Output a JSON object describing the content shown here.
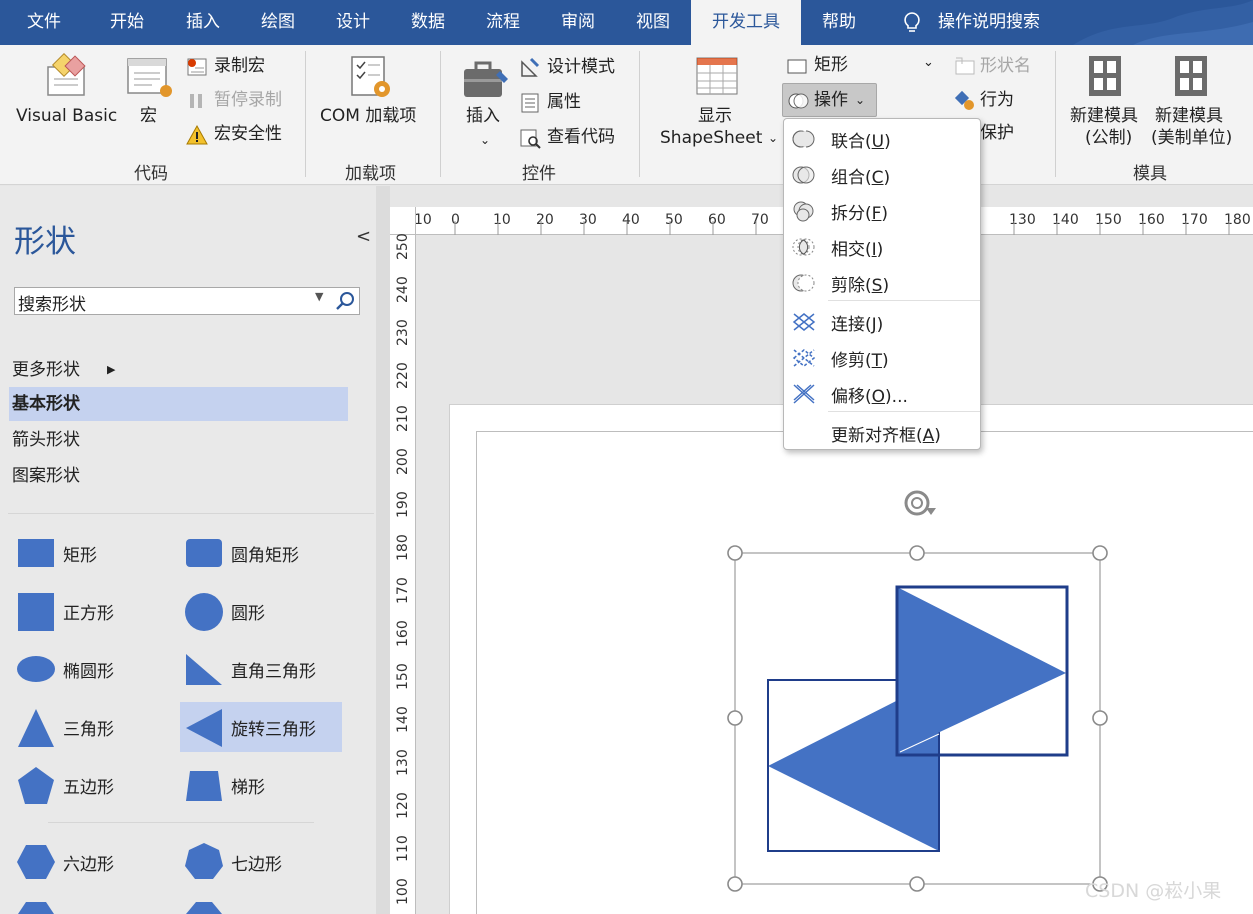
{
  "menubar": {
    "tabs": [
      {
        "label": "文件"
      },
      {
        "label": "开始"
      },
      {
        "label": "插入"
      },
      {
        "label": "绘图"
      },
      {
        "label": "设计"
      },
      {
        "label": "数据"
      },
      {
        "label": "流程"
      },
      {
        "label": "审阅"
      },
      {
        "label": "视图"
      },
      {
        "label": "开发工具"
      },
      {
        "label": "帮助"
      }
    ],
    "active_tab": "开发工具",
    "tell_me": "操作说明搜索",
    "bar_color": "#2b579a"
  },
  "ribbon": {
    "code": {
      "visual_basic": "Visual Basic",
      "macros": "宏",
      "record_macro": "录制宏",
      "pause_recording": "暂停录制",
      "macro_security": "宏安全性",
      "group_label": "代码"
    },
    "addins": {
      "com_addins": "COM 加载项",
      "group_label": "加载项"
    },
    "controls": {
      "insert": "插入",
      "design_mode": "设计模式",
      "properties": "属性",
      "view_code": "查看代码",
      "group_label": "控件"
    },
    "shape_design": {
      "show_shapesheet_line1": "显示",
      "show_shapesheet_line2": "ShapeSheet",
      "rectangle": "矩形",
      "operations": "操作",
      "shape_name": "形状名",
      "behavior": "行为",
      "protection": "保护"
    },
    "stencil": {
      "new_stencil_metric_line1": "新建模具",
      "new_stencil_metric_line2": "(公制)",
      "new_stencil_us_line1": "新建模具",
      "new_stencil_us_line2": "(美制单位)",
      "group_label": "模具"
    }
  },
  "operations_menu": {
    "items": [
      {
        "label": "联合",
        "key": "U",
        "icon": "union-icon"
      },
      {
        "label": "组合",
        "key": "C",
        "icon": "combine-icon"
      },
      {
        "label": "拆分",
        "key": "F",
        "icon": "fragment-icon"
      },
      {
        "label": "相交",
        "key": "I",
        "icon": "intersect-icon"
      },
      {
        "label": "剪除",
        "key": "S",
        "icon": "subtract-icon"
      },
      {
        "label": "连接",
        "key": "J",
        "icon": "join-icon"
      },
      {
        "label": "修剪",
        "key": "T",
        "icon": "trim-icon"
      },
      {
        "label": "偏移",
        "key": "O",
        "suffix": "...",
        "icon": "offset-icon"
      },
      {
        "label": "更新对齐框",
        "key": "A",
        "icon": ""
      }
    ]
  },
  "shapes_pane": {
    "title": "形状",
    "search_placeholder": "搜索形状",
    "more_shapes": "更多形状",
    "stencils": [
      {
        "label": "基本形状",
        "selected": true
      },
      {
        "label": "箭头形状",
        "selected": false
      },
      {
        "label": "图案形状",
        "selected": false
      }
    ],
    "shapes": [
      {
        "label": "矩形"
      },
      {
        "label": "圆角矩形"
      },
      {
        "label": "正方形"
      },
      {
        "label": "圆形"
      },
      {
        "label": "椭圆形"
      },
      {
        "label": "直角三角形"
      },
      {
        "label": "三角形"
      },
      {
        "label": "旋转三角形"
      },
      {
        "label": "五边形"
      },
      {
        "label": "梯形"
      },
      {
        "label": "六边形"
      },
      {
        "label": "七边形"
      }
    ],
    "shape_fill": "#4472c4",
    "selected_fill": "#c5d2ef"
  },
  "rulers": {
    "horizontal": [
      "10",
      "0",
      "10",
      "20",
      "30",
      "40",
      "50",
      "60",
      "70",
      "130",
      "140",
      "150",
      "160",
      "170",
      "180"
    ],
    "vertical": [
      "250",
      "240",
      "230",
      "220",
      "210",
      "200",
      "190",
      "180",
      "170",
      "160",
      "150",
      "140",
      "130",
      "120",
      "110",
      "100"
    ]
  },
  "watermark": "CSDN @崧小果"
}
